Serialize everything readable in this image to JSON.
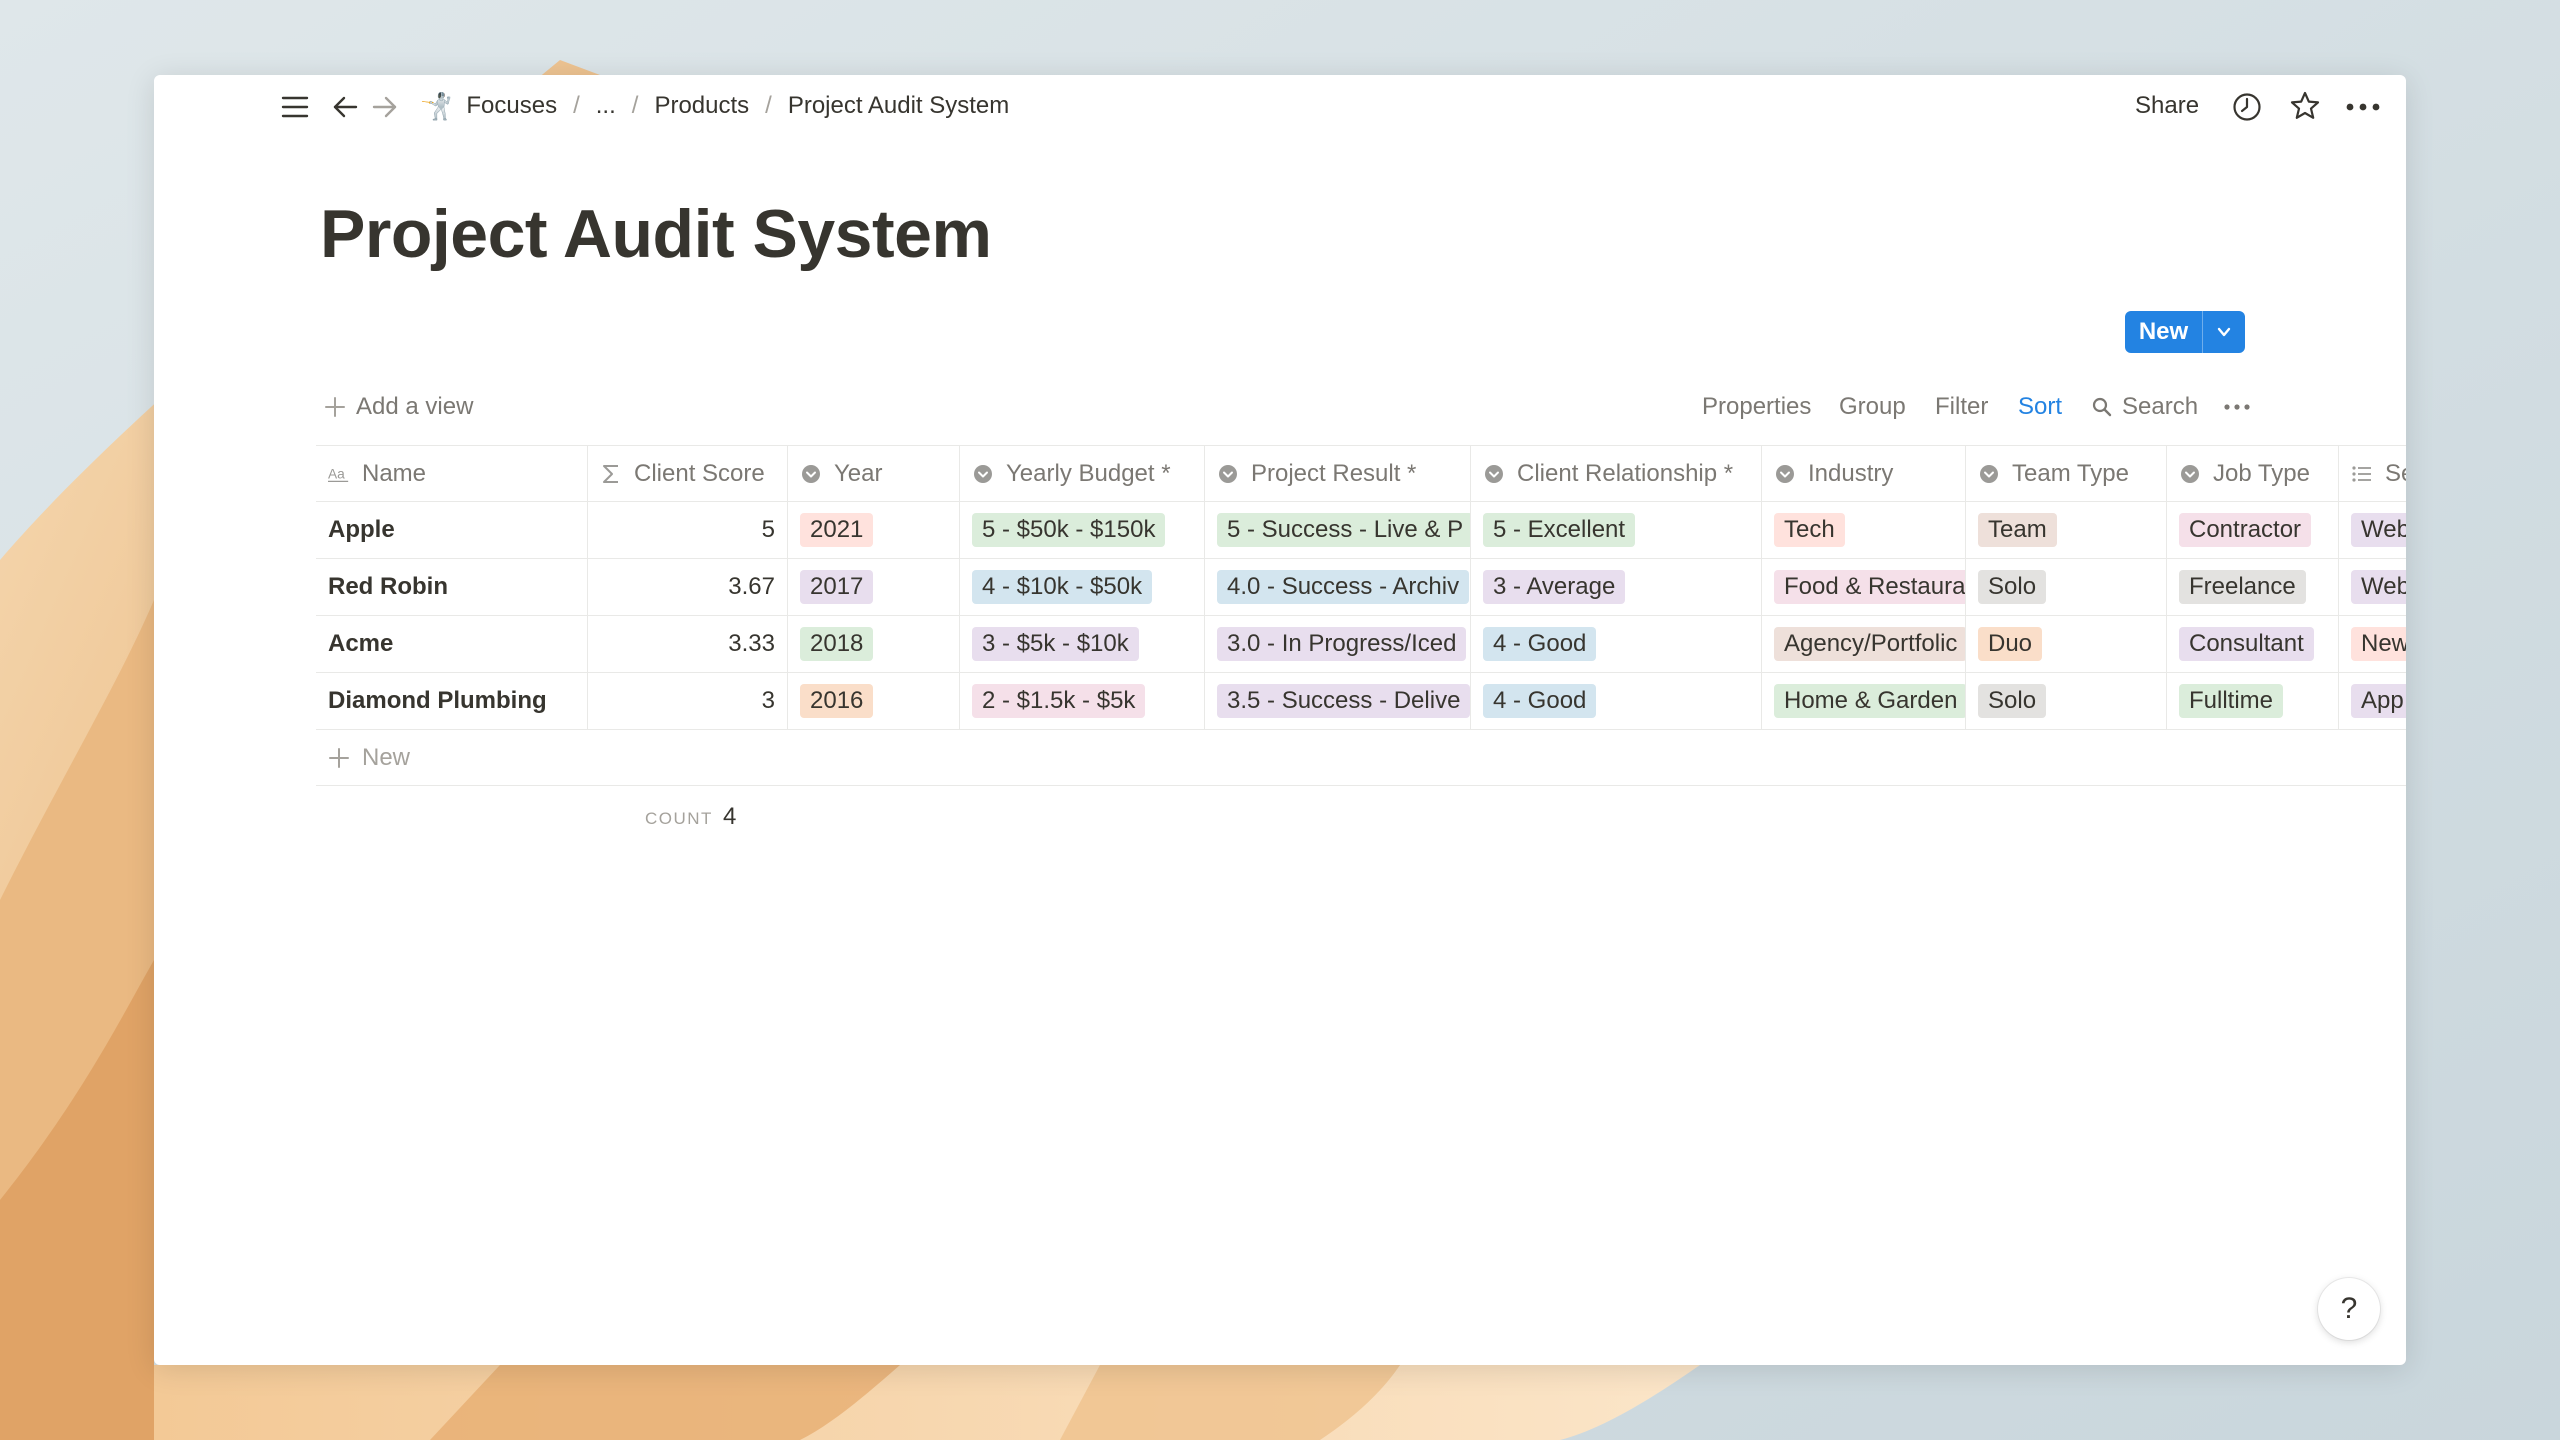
{
  "topbar": {
    "breadcrumb": [
      {
        "label": "Focuses",
        "emoji": "🤺"
      },
      {
        "label": "..."
      },
      {
        "label": "Products"
      },
      {
        "label": "Project Audit System"
      }
    ],
    "separator": "/",
    "share_label": "Share"
  },
  "page": {
    "title": "Project Audit System"
  },
  "viewbar": {
    "add_view": "Add a view",
    "properties": "Properties",
    "group": "Group",
    "filter": "Filter",
    "sort": "Sort",
    "search": "Search",
    "new": "New"
  },
  "table": {
    "columns": [
      {
        "label": "Name",
        "icon": "text-aa-icon"
      },
      {
        "label": "Client Score",
        "icon": "sigma-icon"
      },
      {
        "label": "Year",
        "icon": "select-icon"
      },
      {
        "label": "Yearly Budget *",
        "icon": "select-icon"
      },
      {
        "label": "Project Result *",
        "icon": "select-icon"
      },
      {
        "label": "Client Relationship *",
        "icon": "select-icon"
      },
      {
        "label": "Industry",
        "icon": "select-icon"
      },
      {
        "label": "Team Type",
        "icon": "select-icon"
      },
      {
        "label": "Job Type",
        "icon": "select-icon"
      },
      {
        "label": "Se",
        "icon": "list-icon"
      }
    ],
    "rows": [
      {
        "name": "Apple",
        "score": "5",
        "year": "2021",
        "budget": "5 - $50k - $150k",
        "result": "5 - Success - Live & P",
        "relationship": "5 - Excellent",
        "industry": "Tech",
        "team": "Team",
        "job": "Contractor",
        "extra": "Web"
      },
      {
        "name": "Red Robin",
        "score": "3.67",
        "year": "2017",
        "budget": "4 - $10k - $50k",
        "result": "4.0 - Success - Archiv",
        "relationship": "3 - Average",
        "industry": "Food & Restaura",
        "team": "Solo",
        "job": "Freelance",
        "extra": "Web"
      },
      {
        "name": "Acme",
        "score": "3.33",
        "year": "2018",
        "budget": "3 - $5k - $10k",
        "result": "3.0 - In Progress/Iced",
        "relationship": "4 - Good",
        "industry": "Agency/Portfolic",
        "team": "Duo",
        "job": "Consultant",
        "extra": "New"
      },
      {
        "name": "Diamond Plumbing",
        "score": "3",
        "year": "2016",
        "budget": "2 - $1.5k - $5k",
        "result": "3.5 - Success - Delive",
        "relationship": "4 - Good",
        "industry": "Home & Garden",
        "team": "Solo",
        "job": "Fulltime",
        "extra": "App"
      }
    ],
    "new_row_label": "New",
    "count_label": "COUNT",
    "count_value": "4"
  },
  "help": {
    "label": "?"
  },
  "colors": {
    "accent": "#2383e2",
    "tag_red": "#ffe2dd",
    "tag_purple": "#e8deee",
    "tag_green": "#dbeddb",
    "tag_orange": "#fadec9",
    "tag_blue": "#d3e5ef",
    "tag_pink": "#f5e0e9",
    "tag_gray": "#e3e2e0"
  }
}
